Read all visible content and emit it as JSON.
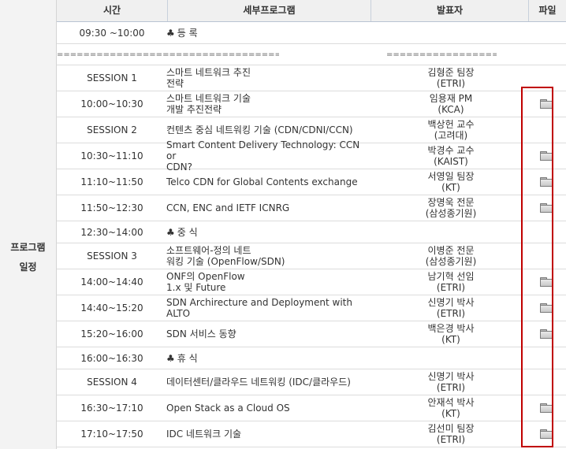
{
  "header": {
    "time": "시간",
    "program": "세부프로그램",
    "speaker": "발표자",
    "file": "파일"
  },
  "side_label": {
    "line1": "프로그램",
    "line2": "일정"
  },
  "separator": {
    "left": "==============================================",
    "right": "========================="
  },
  "rows": [
    {
      "time": "09:30 ~10:00",
      "club": "♣",
      "program": "등 록",
      "speaker": "",
      "file": false
    },
    {
      "time": "SESSION 1",
      "program": "스마트 네트워크 추진\n전략",
      "speaker": "김형준 팀장\n(ETRI)",
      "file": false
    },
    {
      "time": "10:00~10:30",
      "program": "스마트 네트워크 기술\n개발 추진전략",
      "speaker": "임용재 PM\n(KCA)",
      "file": true
    },
    {
      "time": "SESSION 2",
      "program": "컨텐츠 중심 네트워킹 기술 (CDN/CDNI/CCN)",
      "speaker": "백상헌 교수\n(고려대)",
      "file": false
    },
    {
      "time": "10:30~11:10",
      "program": "Smart Content Delivery Technology: CCN or\nCDN?",
      "speaker": "박경수 교수\n(KAIST)",
      "file": true
    },
    {
      "time": "11:10~11:50",
      "program": "Telco CDN for Global Contents exchange",
      "speaker": "서영일 팀장\n(KT)",
      "file": true
    },
    {
      "time": "11:50~12:30",
      "program": "CCN, ENC and IETF ICNRG",
      "speaker": "장명욱 전문\n(삼성종기원)",
      "file": true
    },
    {
      "time": "12:30~14:00",
      "club": "♣",
      "program": "중 식",
      "speaker": "",
      "file": false
    },
    {
      "time": "SESSION 3",
      "program": "소프트웨어-정의 네트\n워킹 기술 (OpenFlow/SDN)",
      "speaker": "이병준 전문\n(삼성종기원)",
      "file": false
    },
    {
      "time": "14:00~14:40",
      "program": "ONF의 OpenFlow\n1.x 및 Future",
      "speaker": "남기혁 선임\n(ETRI)",
      "file": true
    },
    {
      "time": "14:40~15:20",
      "program": "SDN Archirecture and Deployment with ALTO",
      "speaker": "신명기 박사\n(ETRI)",
      "file": true
    },
    {
      "time": "15:20~16:00",
      "program": "SDN 서비스 동향",
      "speaker": "백은경 박사\n(KT)",
      "file": true
    },
    {
      "time": "16:00~16:30",
      "club": "♣",
      "program": "휴 식",
      "speaker": "",
      "file": false
    },
    {
      "time": "SESSION 4",
      "program": "데이터센터/클라우드 네트워킹 (IDC/클라우드)",
      "speaker": "신명기 박사\n(ETRI)",
      "file": false
    },
    {
      "time": "16:30~17:10",
      "program": "Open Stack as a Cloud OS",
      "speaker": "안재석 박사\n(KT)",
      "file": true
    },
    {
      "time": "17:10~17:50",
      "program": "IDC 네트워크 기술",
      "speaker": "김선미 팀장\n(ETRI)",
      "file": true
    }
  ]
}
